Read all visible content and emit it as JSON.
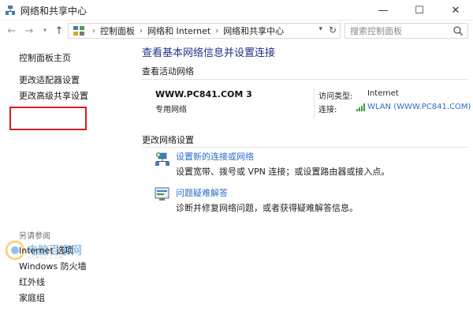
{
  "window": {
    "title": "网络和共享中心",
    "controls": {
      "minimize": "—",
      "maximize": "☐",
      "close": "✕"
    }
  },
  "address": {
    "breadcrumbs": [
      "控制面板",
      "网络和 Internet",
      "网络和共享中心"
    ],
    "search_placeholder": "搜索控制面板"
  },
  "sidebar": {
    "home": "控制面板主页",
    "items": [
      "更改适配器设置",
      "更改高级共享设置"
    ],
    "see_also_heading": "另请参阅",
    "see_also": [
      "Internet 选项",
      "Windows 防火墙",
      "红外线",
      "家庭组"
    ]
  },
  "watermark": {
    "text": "电脑百事网",
    "sub": "PC841.COM"
  },
  "main": {
    "title": "查看基本网络信息并设置连接",
    "active_heading": "查看活动网络",
    "network": {
      "name": "WWW.PC841.COM  3",
      "type": "专用网络",
      "access_label": "访问类型:",
      "access_value": "Internet",
      "connection_label": "连接:",
      "connection_value": "WLAN (WWW.PC841.COM)"
    },
    "change_heading": "更改网络设置",
    "tasks": [
      {
        "link": "设置新的连接或网络",
        "desc": "设置宽带、拨号或 VPN 连接；或设置路由器或接入点。"
      },
      {
        "link": "问题疑难解答",
        "desc": "诊断并修复网络问题，或者获得疑难解答信息。"
      }
    ]
  },
  "colors": {
    "link": "#2c6fc8",
    "title": "#1e3287",
    "highlight": "#d0202a"
  }
}
